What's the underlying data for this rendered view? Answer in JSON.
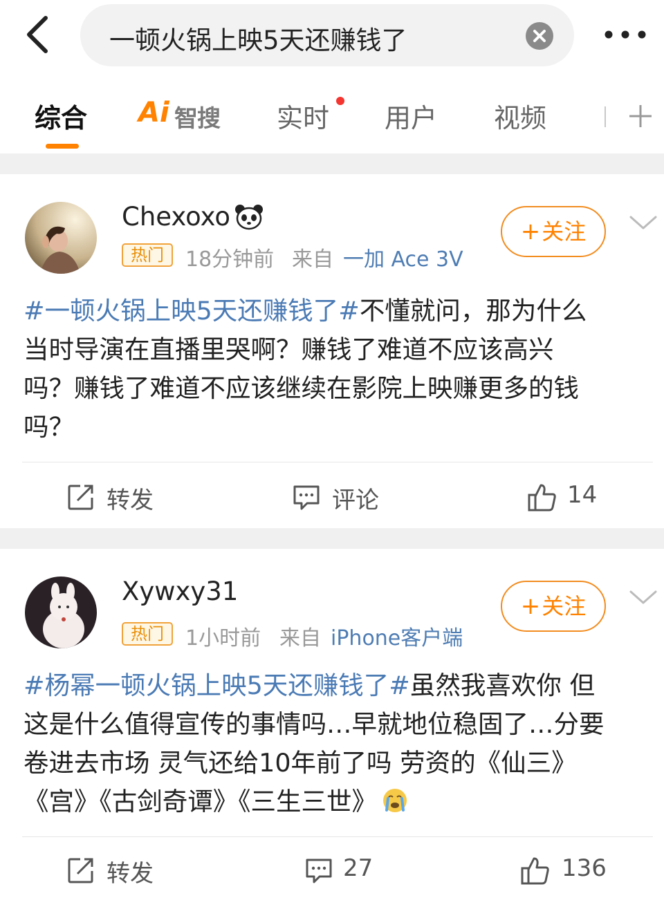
{
  "header": {
    "search_query": "一顿火锅上映5天还赚钱了"
  },
  "tabs": [
    {
      "label": "综合"
    },
    {
      "label": "智搜",
      "prefix": "Ai"
    },
    {
      "label": "实时"
    },
    {
      "label": "用户"
    },
    {
      "label": "视频"
    }
  ],
  "posts": [
    {
      "username": "Chexoxo",
      "hot_label": "热门",
      "time": "18分钟前",
      "from_label": "来自",
      "source": "一加 Ace 3V",
      "follow_label": "关注",
      "body": {
        "line1_hashtag": "#一顿火锅上映5天还赚钱了#",
        "line1_text": "不懂就问，那为什么",
        "line2": "当时导演在直播里哭啊？赚钱了难道不应该高兴",
        "line3": "吗？赚钱了难道不应该继续在影院上映赚更多的钱",
        "line4": "吗？"
      },
      "actions": {
        "repost": "转发",
        "comment": "评论",
        "likes": "14"
      }
    },
    {
      "username": "Xywxy31",
      "hot_label": "热门",
      "time": "1小时前",
      "from_label": "来自",
      "source": "iPhone客户端",
      "follow_label": "关注",
      "body": {
        "line1_hashtag": "#杨幂一顿火锅上映5天还赚钱了#",
        "line1_text": "虽然我喜欢你 但",
        "line2": "这是什么值得宣传的事情吗…早就地位稳固了…分要",
        "line3": "卷进去市场 灵气还给10年前了吗 劳资的《仙三》",
        "line4": "《宫》《古剑奇谭》《三生三世》"
      },
      "actions": {
        "repost": "转发",
        "comments": "27",
        "likes": "136"
      }
    }
  ],
  "colors": {
    "accent": "#ff8200",
    "link": "#4a7ab4",
    "badge_red": "#f43530"
  },
  "icons": [
    "back-arrow-icon",
    "clear-icon",
    "more-icon",
    "add-icon",
    "panda-icon",
    "chevron-down-icon",
    "repost-icon",
    "comment-icon",
    "like-icon",
    "crying-emoji-icon"
  ]
}
